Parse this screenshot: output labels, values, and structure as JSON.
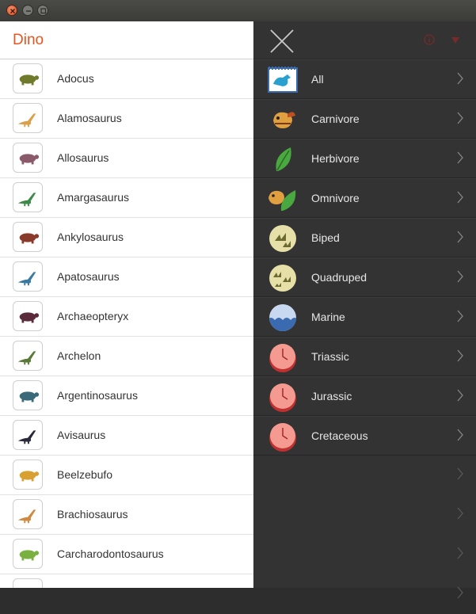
{
  "app": {
    "title": "Dino"
  },
  "dinos": [
    {
      "name": "Adocus",
      "color": "#6f7a2a"
    },
    {
      "name": "Alamosaurus",
      "color": "#d8a14a"
    },
    {
      "name": "Allosaurus",
      "color": "#8a5a6a"
    },
    {
      "name": "Amargasaurus",
      "color": "#3f8a4a"
    },
    {
      "name": "Ankylosaurus",
      "color": "#8a3a2a"
    },
    {
      "name": "Apatosaurus",
      "color": "#3a7aa0"
    },
    {
      "name": "Archaeopteryx",
      "color": "#5a2a3a"
    },
    {
      "name": "Archelon",
      "color": "#5a7a3a"
    },
    {
      "name": "Argentinosaurus",
      "color": "#3a6a7a"
    },
    {
      "name": "Avisaurus",
      "color": "#2a2a3a"
    },
    {
      "name": "Beelzebufo",
      "color": "#d8a030"
    },
    {
      "name": "Brachiosaurus",
      "color": "#d08a40"
    },
    {
      "name": "Carcharodontosaurus",
      "color": "#7ab040"
    }
  ],
  "filters": [
    {
      "label": "All",
      "icon": "all-icon"
    },
    {
      "label": "Carnivore",
      "icon": "carnivore-icon"
    },
    {
      "label": "Herbivore",
      "icon": "herbivore-icon"
    },
    {
      "label": "Omnivore",
      "icon": "omnivore-icon"
    },
    {
      "label": "Biped",
      "icon": "biped-icon"
    },
    {
      "label": "Quadruped",
      "icon": "quadruped-icon"
    },
    {
      "label": "Marine",
      "icon": "marine-icon"
    },
    {
      "label": "Triassic",
      "icon": "triassic-icon"
    },
    {
      "label": "Jurassic",
      "icon": "jurassic-icon"
    },
    {
      "label": "Cretaceous",
      "icon": "cretaceous-icon"
    }
  ],
  "colors": {
    "accent": "#e95420",
    "panel": "#333333"
  }
}
